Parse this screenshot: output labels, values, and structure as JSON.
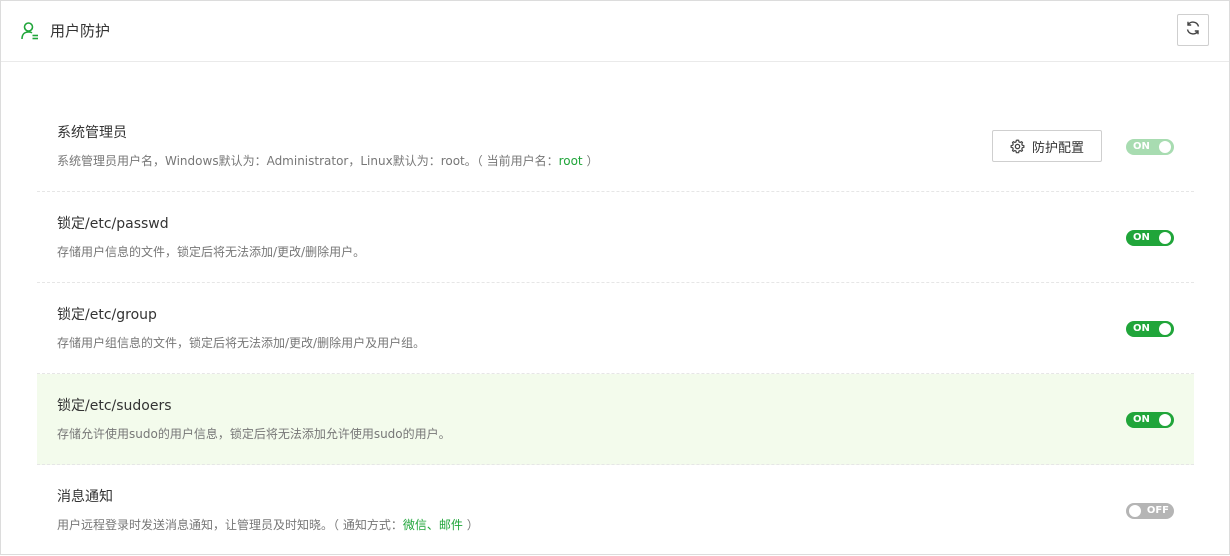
{
  "header": {
    "title": "用户防护",
    "icon": "user-shield-icon",
    "refresh_icon": "refresh-icon"
  },
  "colors": {
    "accent": "#20a53a",
    "highlight_bg": "#f3fbec",
    "toggle_off": "#b5b5b5"
  },
  "items": [
    {
      "title": "系统管理员",
      "desc": "系统管理员用户名，Windows默认为：Administrator，Linux默认为：root。（ 当前用户名：",
      "desc_value": "root",
      "desc_suffix": " ）",
      "button_label": "防护配置",
      "toggle": "ON"
    },
    {
      "title": "锁定/etc/passwd",
      "desc": "存储用户信息的文件，锁定后将无法添加/更改/删除用户。",
      "toggle": "ON"
    },
    {
      "title": "锁定/etc/group",
      "desc": "存储用户组信息的文件，锁定后将无法添加/更改/删除用户及用户组。",
      "toggle": "ON"
    },
    {
      "title": "锁定/etc/sudoers",
      "desc": "存储允许使用sudo的用户信息，锁定后将无法添加允许使用sudo的用户。",
      "toggle": "ON"
    },
    {
      "title": "消息通知",
      "desc": "用户远程登录时发送消息通知，让管理员及时知晓。（ 通知方式：",
      "desc_links": [
        "微信",
        "邮件"
      ],
      "desc_separator": "、",
      "desc_suffix": " ）",
      "toggle": "OFF"
    }
  ]
}
